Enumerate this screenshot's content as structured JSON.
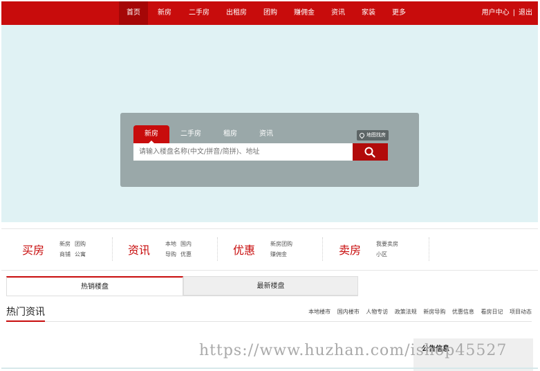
{
  "nav": {
    "items": [
      "首页",
      "新房",
      "二手房",
      "出租房",
      "团购",
      "赚佣金",
      "资讯",
      "家装",
      "更多"
    ],
    "user_center": "用户中心",
    "separator": "|",
    "logout": "退出"
  },
  "search": {
    "tabs": [
      "新房",
      "二手房",
      "租房",
      "资讯"
    ],
    "active_tab": "新房",
    "map_button": "地图找房",
    "placeholder": "请输入楼盘名称(中文/拼音/简拼)、地址"
  },
  "categories": [
    {
      "title": "买房",
      "links": [
        "新房",
        "团购",
        "商铺",
        "公寓"
      ]
    },
    {
      "title": "资讯",
      "links": [
        "本地",
        "国内",
        "导购",
        "优惠"
      ]
    },
    {
      "title": "优惠",
      "links": [
        "新房团购",
        "赚佣金"
      ]
    },
    {
      "title": "卖房",
      "links": [
        "我要卖房",
        "小区"
      ]
    }
  ],
  "listing_tabs": {
    "hot": "热销楼盘",
    "latest": "最新楼盘"
  },
  "news": {
    "title": "热门资讯",
    "links": [
      "本地楼市",
      "国内楼市",
      "人物专访",
      "政策法规",
      "新房导购",
      "优惠信息",
      "看房日记",
      "项目动态"
    ]
  },
  "notice": {
    "title": "公告信息"
  },
  "watermark": "https://www.huzhan.com/ishop45527",
  "colors": {
    "brand_red": "#c80c0c",
    "hero_bg": "#e0f2f4",
    "search_panel": "#9aa8a9"
  }
}
